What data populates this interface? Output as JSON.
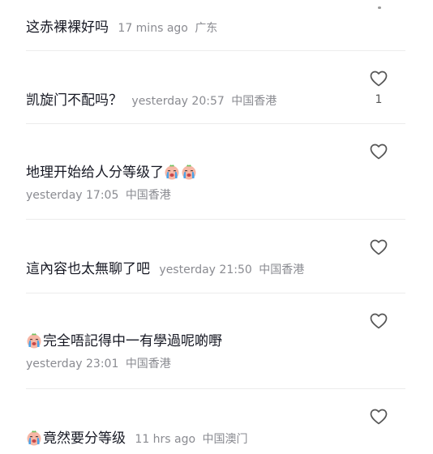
{
  "colors": {
    "text": "#161823",
    "meta": "#8a8b91",
    "divider": "#ececec",
    "icon": "#555555"
  },
  "comments": [
    {
      "text": "这赤裸裸好吗",
      "time": "17 mins ago",
      "location": "广东",
      "leading_emoji": null,
      "trailing_emojis": 0,
      "like_count": "",
      "like_icon": "heart-outline-icon"
    },
    {
      "text": "凯旋门不配吗？",
      "time": "yesterday 20:57",
      "location": "中国香港",
      "leading_emoji": null,
      "trailing_emojis": 0,
      "like_count": "1",
      "like_icon": "heart-outline-icon"
    },
    {
      "text": "地理开始给人分等级了",
      "time": "yesterday 17:05",
      "location": "中国香港",
      "leading_emoji": null,
      "trailing_emojis": 2,
      "emoji_name": "crying-face-emoji",
      "like_count": "",
      "like_icon": "heart-outline-icon"
    },
    {
      "text": "這內容也太無聊了吧",
      "time": "yesterday 21:50",
      "location": "中国香港",
      "leading_emoji": null,
      "trailing_emojis": 0,
      "like_count": "",
      "like_icon": "heart-outline-icon"
    },
    {
      "text": "完全唔記得中一有學過呢啲嘢",
      "time": "yesterday 23:01",
      "location": "中国香港",
      "leading_emoji": "crying-face-emoji",
      "trailing_emojis": 0,
      "like_count": "",
      "like_icon": "heart-outline-icon"
    },
    {
      "text": "竟然要分等级",
      "time": "11 hrs ago",
      "location": "中国澳门",
      "leading_emoji": "crying-face-emoji",
      "trailing_emojis": 0,
      "like_count": "",
      "like_icon": "heart-outline-icon"
    }
  ]
}
